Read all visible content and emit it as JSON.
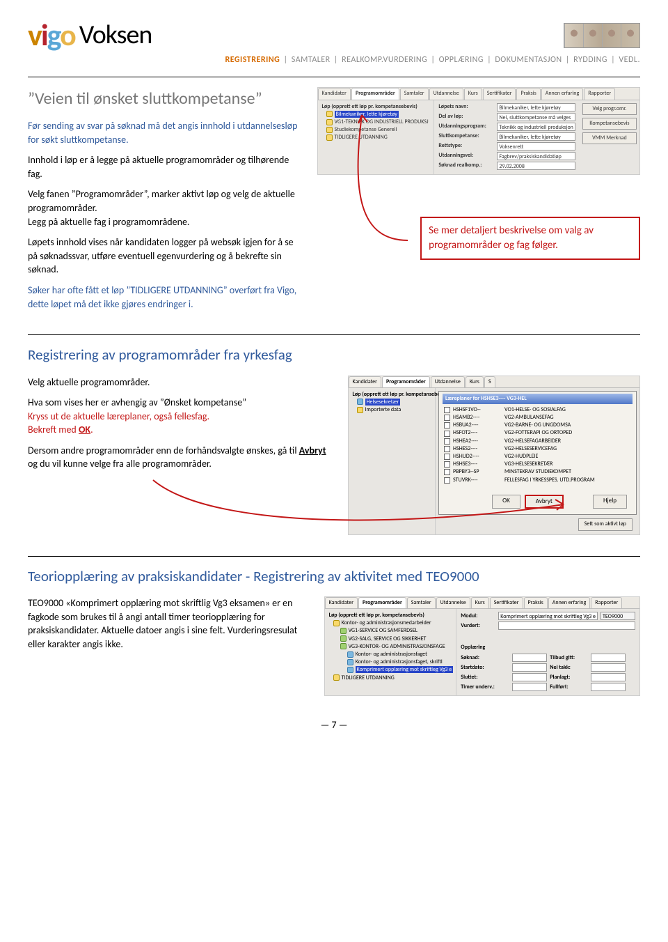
{
  "header": {
    "logo_word2": "Voksen",
    "nav": [
      "REGISTRERING",
      "SAMTALER",
      "REALKOMP.VURDERING",
      "OPPLÆRING",
      "DOKUMENTASJON",
      "RYDDING",
      "VEDL."
    ],
    "nav_active": 0
  },
  "section1": {
    "title": "”Veien til ønsket sluttkompetanse”",
    "p1": "Før sending av svar på søknad må det angis innhold i utdannelsesløp for søkt sluttkompetanse.",
    "p2": "Innhold i løp er å legge på aktuelle programområder og tilhørende fag.",
    "p3": "Velg fanen ”Programområder”, marker aktivt løp og velg de aktuelle programområder.\nLegg på aktuelle fag i programområdene.",
    "p4": "Løpets innhold vises når kandidaten logger på websøk igjen for å se på søknadssvar, utføre eventuell egenvurdering og å bekrefte sin søknad.",
    "p5": "Søker har ofte fått et løp ”TIDLIGERE UTDANNING” overført fra Vigo, dette løpet må det ikke gjøres endringer i.",
    "callout": "Se mer detaljert beskrivelse om valg av programområder og fag følger."
  },
  "sshot1": {
    "tabs": [
      "Kandidater",
      "Programområder",
      "Samtaler",
      "Utdannelse",
      "Kurs",
      "Sertifikater",
      "Praksis",
      "Annen erfaring",
      "Rapporter"
    ],
    "tabs_active": 1,
    "tree_header": "Løp (opprett ett løp pr. kompetansebevis)",
    "tree": [
      {
        "sel": true,
        "label": "Bilmekaniker, lette kjøretøy"
      },
      {
        "label": "VG1-TEKNIKK OG INDUSTRIELL PRODUKSJ"
      },
      {
        "label": "Studiekompetanse Generell"
      },
      {
        "label": "TIDLIGERE UTDANNING"
      }
    ],
    "fields": [
      {
        "lbl": "Løpets navn:",
        "val": "Bilmekaniker, lette kjøretøy"
      },
      {
        "lbl": "Del av løp:",
        "val": "Nei, sluttkompetanse må velges"
      },
      {
        "lbl": "Utdanningsprogram:",
        "val": "Teknikk og industriell produksjon"
      },
      {
        "lbl": "Sluttkompetanse:",
        "val": "Bilmekaniker, lette kjøretøy"
      },
      {
        "lbl": "Rettstype:",
        "val": "Voksenrett"
      },
      {
        "lbl": "Utdanningsvei:",
        "val": "Fagbrev/praksiskandidatløp"
      },
      {
        "lbl": "Søknad realkomp.:",
        "val": "29.02.2008"
      }
    ],
    "side_btns": [
      "Velg progr.omr.",
      "Kompetansebevis",
      "VMM Merknad"
    ]
  },
  "section2": {
    "title": "Registrering av programområder fra yrkesfag",
    "p1": "Velg aktuelle programområder.",
    "p2a": "Hva som vises her er avhengig av ”Ønsket kompetanse”",
    "p2b": "Kryss ut de aktuelle læreplaner, også fellesfag.",
    "p2c_pre": "Bekreft  med ",
    "p2c_ok": "OK",
    "p2c_post": ".",
    "p3_pre": "Dersom andre programområder enn de forhåndsvalgte ønskes, gå til ",
    "p3_avbryt": "Avbryt",
    "p3_post": " og du vil kunne velge fra alle programområder."
  },
  "sshot2": {
    "tabs": [
      "Kandidater",
      "Programområder",
      "Utdannelse",
      "Kurs",
      "S"
    ],
    "tree_header": "Løp (opprett ett løp pr. kompetansebevis)",
    "tree": [
      "Helsesekretær",
      "Importerte data"
    ],
    "dlg_title": "Læreplaner for HSHSE3---- VG3-HEL",
    "rows": [
      {
        "code": "HSHSF1VO--",
        "name": "VO1-HELSE- OG SOSIALFAG"
      },
      {
        "code": "HSAMB2----",
        "name": "VG2-AMBULANSEFAG"
      },
      {
        "code": "HSBUA2----",
        "name": "VG2-BARNE- OG UNGDOMSA"
      },
      {
        "code": "HSFOT2----",
        "name": "VG2-FOTTERAPI OG ORTOPED"
      },
      {
        "code": "HSHEA2----",
        "name": "VG2-HELSEFAGARBEIDER"
      },
      {
        "code": "HSHES2----",
        "name": "VG2-HELSESERVICEFAG"
      },
      {
        "code": "HSHUD2----",
        "name": "VG2-HUDPLEIE"
      },
      {
        "code": "HSHSE3----",
        "name": "VG3-HELSESEKRETÆR"
      },
      {
        "code": "PBPBY3--SP",
        "name": "MINSTEKRAV STUDIEKOMPET"
      },
      {
        "code": "STUVRK----",
        "name": "FELLESFAG I YRKESSPES. UTD.PROGRAM"
      }
    ],
    "btn_ok": "OK",
    "btn_avbryt": "Avbryt",
    "btn_sett": "Sett som aktivt løp",
    "btn_hjelp": "Hjelp"
  },
  "section3": {
    "title": "Teoriopplæring av praksiskandidater - Registrering av aktivitet  med TEO9000",
    "p1": "TEO9000 «Komprimert opplæring mot skriftlig Vg3 eksamen» er en fagkode som brukes til å angi antall timer teoriopplæring for praksiskandidater.  Aktuelle datoer angis i sine felt.  Vurderingsresulat eller karakter angis ikke."
  },
  "sshot3": {
    "tabs": [
      "Kandidater",
      "Programområder",
      "Samtaler",
      "Utdannelse",
      "Kurs",
      "Sertifikater",
      "Praksis",
      "Annen erfaring",
      "Rapporter"
    ],
    "tree_header": "Løp (opprett ett løp pr. kompetansebevis)",
    "tree": [
      "Kontor- og administrasjonsmedarbeider",
      "VG1-SERVICE OG SAMFERDSEL",
      "VG2-SALG, SERVICE OG SIKKERHET",
      "VG3-KONTOR- OG ADMINISTRASJONSFAGE",
      "Kontor- og administrasjonsfaget",
      "Kontor- og administrasjonsfaget, skriftl",
      "Komprimert opplæring mot skriftleg Vg3 e",
      "TIDLIGERE UTDANNING"
    ],
    "tree_sel": 6,
    "right_fields": [
      {
        "lbl": "Modul:",
        "val": "Komprimert opplæring mot skriftleg Vg3 e"
      },
      {
        "lbl": "Vurdert:",
        "val": ""
      }
    ],
    "right_code": "TEO9000",
    "right_section_label": "Opplæring",
    "right_pairs": [
      [
        "Søknad:",
        "Tilbud gitt:"
      ],
      [
        "Startdato:",
        "Nei takk:"
      ],
      [
        "Sluttet:",
        "Planlagt:"
      ],
      [
        "Timer underv.:",
        "Fullført:"
      ]
    ]
  },
  "footer": {
    "page": "7"
  }
}
